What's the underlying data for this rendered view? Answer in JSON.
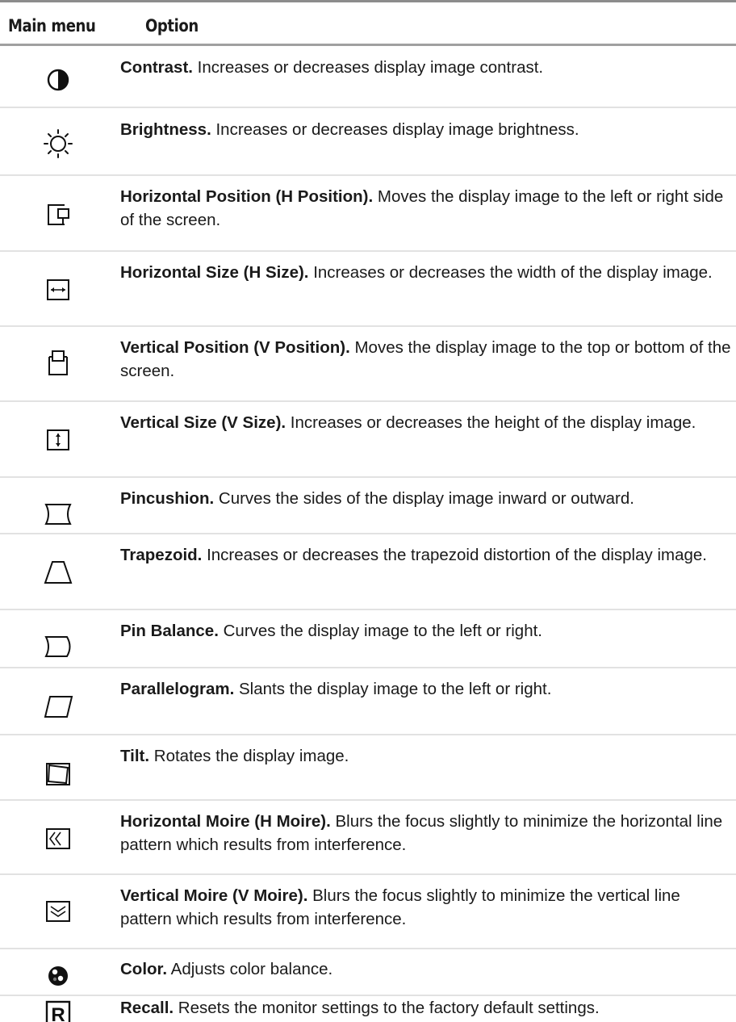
{
  "header": {
    "col_main": "Main menu",
    "col_option": "Option"
  },
  "rows": [
    {
      "icon": "contrast-icon",
      "name": "Contrast.",
      "desc": " Increases or decreases display image contrast."
    },
    {
      "icon": "brightness-icon",
      "name": "Brightness.",
      "desc": " Increases or decreases display image brightness."
    },
    {
      "icon": "h-position-icon",
      "name": "Horizontal Position (H Position).",
      "desc": " Moves the display image to the left or right side of the screen."
    },
    {
      "icon": "h-size-icon",
      "name": "Horizontal Size (H Size).",
      "desc": " Increases or decreases the width of the display image."
    },
    {
      "icon": "v-position-icon",
      "name": "Vertical Position (V Position).",
      "desc": " Moves the display image to the top or bottom of the screen."
    },
    {
      "icon": "v-size-icon",
      "name": "Vertical Size (V Size).",
      "desc": " Increases or decreases the height of the display image."
    },
    {
      "icon": "pincushion-icon",
      "name": "Pincushion.",
      "desc": " Curves the sides of the display image inward or outward."
    },
    {
      "icon": "trapezoid-icon",
      "name": "Trapezoid.",
      "desc": " Increases or decreases the trapezoid distortion of the display image."
    },
    {
      "icon": "pin-balance-icon",
      "name": "Pin Balance.",
      "desc": " Curves the display image to the left or right."
    },
    {
      "icon": "parallelogram-icon",
      "name": "Parallelogram.",
      "desc": " Slants the display image to the left or right."
    },
    {
      "icon": "tilt-icon",
      "name": "Tilt.",
      "desc": " Rotates the display image."
    },
    {
      "icon": "h-moire-icon",
      "name": "Horizontal Moire (H Moire).",
      "desc": " Blurs the focus slightly to minimize the horizontal line pattern which results from interference."
    },
    {
      "icon": "v-moire-icon",
      "name": "Vertical Moire (V Moire).",
      "desc": " Blurs the focus slightly to minimize the vertical line pattern which results from interference."
    },
    {
      "icon": "color-icon",
      "name": "Color.",
      "desc": " Adjusts color balance."
    },
    {
      "icon": "recall-icon",
      "name": "Recall.",
      "desc": " Resets the monitor settings to the factory default settings."
    }
  ]
}
